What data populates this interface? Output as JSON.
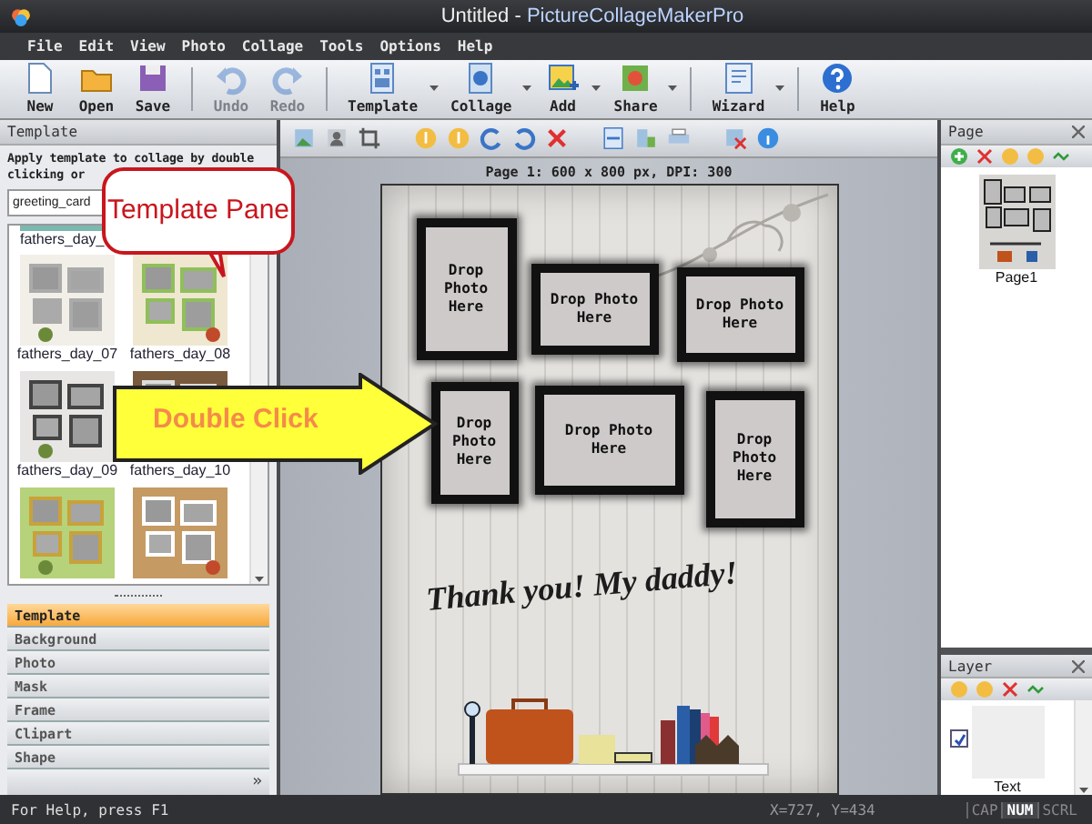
{
  "window": {
    "document": "Untitled -",
    "app": "PictureCollageMakerPro"
  },
  "menu": [
    "File",
    "Edit",
    "View",
    "Photo",
    "Collage",
    "Tools",
    "Options",
    "Help"
  ],
  "toolbar": [
    [
      {
        "label": "New",
        "disabled": false,
        "dropdown": false
      },
      {
        "label": "Open",
        "disabled": false,
        "dropdown": false
      },
      {
        "label": "Save",
        "disabled": false,
        "dropdown": false
      }
    ],
    [
      {
        "label": "Undo",
        "disabled": true,
        "dropdown": false
      },
      {
        "label": "Redo",
        "disabled": true,
        "dropdown": false
      }
    ],
    [
      {
        "label": "Template",
        "disabled": false,
        "dropdown": true
      },
      {
        "label": "Collage",
        "disabled": false,
        "dropdown": true
      },
      {
        "label": "Add",
        "disabled": false,
        "dropdown": true
      },
      {
        "label": "Share",
        "disabled": false,
        "dropdown": true
      }
    ],
    [
      {
        "label": "Wizard",
        "disabled": false,
        "dropdown": true
      }
    ],
    [
      {
        "label": "Help",
        "disabled": false,
        "dropdown": false
      }
    ]
  ],
  "left_panel": {
    "title": "Template",
    "description": [
      "Apply template to collage by double",
      "clicking or"
    ],
    "dropdown": "greeting_card",
    "cut_labels": [
      "fathers_day_"
    ],
    "templates": [
      {
        "kind": "picture",
        "label": "fathers_day_07"
      },
      {
        "kind": "picture",
        "label": "fathers_day_08"
      },
      {
        "kind": "picture",
        "label": "fathers_day_09"
      },
      {
        "kind": "picture",
        "label": "fathers_day_10"
      },
      {
        "kind": "picture"
      },
      {
        "kind": "picture"
      }
    ],
    "tabs": [
      {
        "label": "Template",
        "selected": true
      },
      {
        "label": "Background",
        "selected": false
      },
      {
        "label": "Photo",
        "selected": false
      },
      {
        "label": "Mask",
        "selected": false
      },
      {
        "label": "Frame",
        "selected": false
      },
      {
        "label": "Clipart",
        "selected": false
      },
      {
        "label": "Shape",
        "selected": false
      }
    ],
    "more": "»"
  },
  "page_info": "Page 1: 600 x 800 px, DPI: 300",
  "canvas": {
    "frames": [
      {
        "label": "Drop Photo Here"
      },
      {
        "label": "Drop Photo Here"
      },
      {
        "label": "Drop Photo Here"
      },
      {
        "label": "Drop Photo Here"
      },
      {
        "label": "Drop Photo Here"
      },
      {
        "label": "Drop Photo Here"
      }
    ],
    "caption": "Thank you! My daddy!"
  },
  "page_panel": {
    "title": "Page",
    "pages": [
      {
        "label": "Page1"
      }
    ]
  },
  "layer_panel": {
    "title": "Layer",
    "layers": [
      {
        "label": "Text",
        "checked": true
      }
    ]
  },
  "status_bar": {
    "help": "For Help, press F1",
    "coords": "X=727, Y=434",
    "indicators": [
      {
        "label": "CAP",
        "on": false
      },
      {
        "label": "NUM",
        "on": true
      },
      {
        "label": "SCRL",
        "on": false
      }
    ]
  },
  "callouts": [
    {
      "kind": "bubble",
      "text": "Template Pane"
    },
    {
      "kind": "arrow",
      "text": "Double Click"
    }
  ]
}
